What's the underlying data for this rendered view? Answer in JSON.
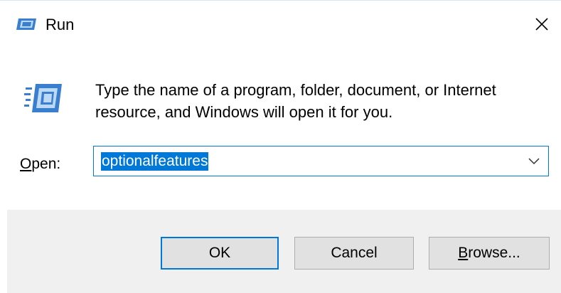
{
  "window": {
    "title": "Run",
    "icon": "run-icon",
    "close_icon": "close-icon"
  },
  "content": {
    "icon": "run-icon",
    "description": "Type the name of a program, folder, document, or Internet resource, and Windows will open it for you.",
    "open_label_accel": "O",
    "open_label_rest": "pen:",
    "open_value": "optionalfeatures",
    "dropdown_icon": "chevron-down-icon"
  },
  "buttons": {
    "ok_label": "OK",
    "cancel_label": "Cancel",
    "browse_accel": "B",
    "browse_rest": "rowse..."
  },
  "colors": {
    "accent": "#0078d7",
    "footer_bg": "#f0f0f0",
    "button_bg": "#e1e1e1"
  }
}
